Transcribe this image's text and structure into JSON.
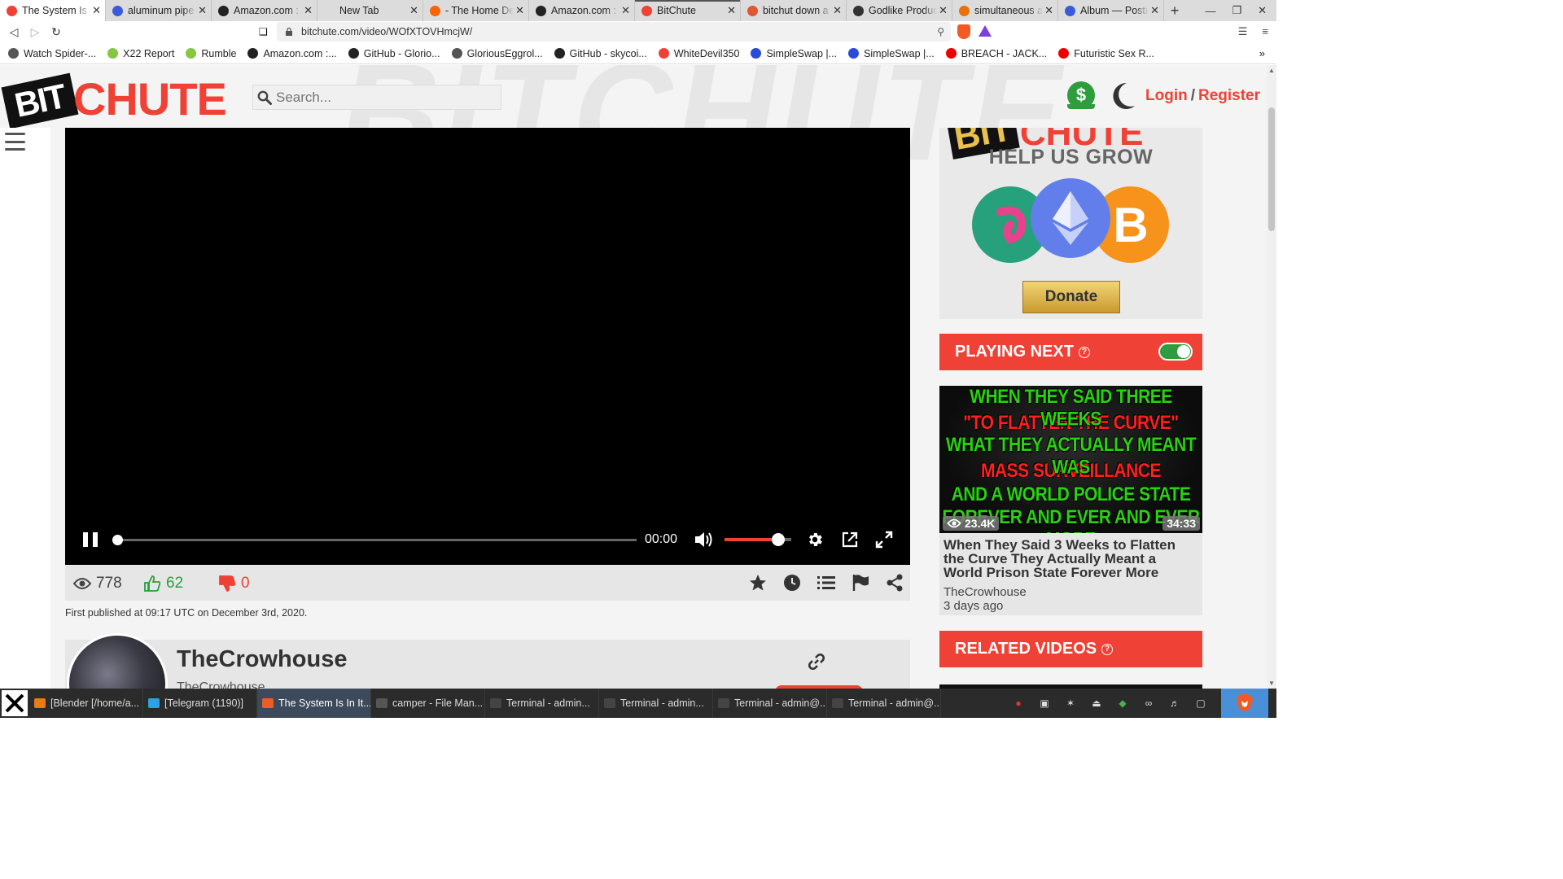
{
  "browser": {
    "tabs": [
      {
        "label": "The System Is In It",
        "fav_color": "#ef4136",
        "active": true
      },
      {
        "label": "aluminum pipe",
        "fav_color": "#3b5bdb"
      },
      {
        "label": "Amazon.com : \\",
        "fav_color": "#222"
      },
      {
        "label": "New Tab",
        "fav_color": ""
      },
      {
        "label": "- The Home Depot",
        "fav_color": "#f96302"
      },
      {
        "label": "Amazon.com : A",
        "fav_color": "#222"
      },
      {
        "label": "BitChute",
        "fav_color": "#ef4136",
        "loading": true
      },
      {
        "label": "bitchut down a",
        "fav_color": "#de5833"
      },
      {
        "label": "Godlike Produc",
        "fav_color": "#333"
      },
      {
        "label": "simultaneous a",
        "fav_color": "#e8710a"
      },
      {
        "label": "Album — Posti",
        "fav_color": "#3b5bdb"
      }
    ],
    "url": "bitchute.com/video/WOfXTOVHmcjW/",
    "bookmarks": [
      {
        "label": "Watch Spider-...",
        "color": "#555"
      },
      {
        "label": "X22 Report",
        "color": "#85c742"
      },
      {
        "label": "Rumble",
        "color": "#85c742"
      },
      {
        "label": "Amazon.com :...",
        "color": "#222"
      },
      {
        "label": "GitHub - Glorio...",
        "color": "#222"
      },
      {
        "label": "GloriousEggrol...",
        "color": "#555"
      },
      {
        "label": "GitHub - skycoi...",
        "color": "#222"
      },
      {
        "label": "WhiteDevil350",
        "color": "#ef4136"
      },
      {
        "label": "SimpleSwap |...",
        "color": "#2a4bd7"
      },
      {
        "label": "SimpleSwap |...",
        "color": "#2a4bd7"
      },
      {
        "label": "BREACH - JACK...",
        "color": "#e00"
      },
      {
        "label": "Futuristic Sex R...",
        "color": "#e00"
      }
    ]
  },
  "site": {
    "logo_bit": "BIT",
    "logo_chute": "CHUTE",
    "watermark": "BITCHUTE",
    "search_placeholder": "Search...",
    "login": "Login",
    "separator": "/",
    "register": "Register",
    "accent": "#ef4136"
  },
  "player": {
    "time": "00:00",
    "progress": 0,
    "volume": 0.8
  },
  "video": {
    "views": "778",
    "likes": "62",
    "dislikes": "0",
    "published": "First published at 09:17 UTC on December 3rd, 2020.",
    "channel_name": "TheCrowhouse",
    "channel_sub": "TheCrowhouse"
  },
  "sidebar": {
    "donate_heading": "HELP US GROW",
    "donate_brand": "CHUTE",
    "donate_btn": "Donate",
    "playing_next": "PLAYING NEXT",
    "playing_next_enabled": true,
    "next": {
      "thumb_lines": [
        {
          "text": "WHEN THEY SAID THREE WEEKS",
          "c": "g"
        },
        {
          "text": "\"TO FLATTEN THE CURVE\"",
          "c": "r"
        },
        {
          "text": "WHAT THEY ACTUALLY MEANT WAS",
          "c": "g"
        },
        {
          "text": "MASS SURVEILLANCE",
          "c": "r"
        },
        {
          "text": "AND A WORLD POLICE STATE",
          "c": "g"
        },
        {
          "text": "FOREVER AND EVER AND EVER MORE",
          "c": "g"
        }
      ],
      "views": "23.4K",
      "duration": "34:33",
      "title": "When They Said 3 Weeks to Flatten the Curve They Actually Meant a World Prison State Forever More",
      "channel": "TheCrowhouse",
      "age": "3 days ago"
    },
    "related": "RELATED VIDEOS"
  },
  "taskbar": {
    "tasks": [
      {
        "label": "[Blender [/home/a...",
        "icon": "#e87d0d"
      },
      {
        "label": "[Telegram (1190)]",
        "icon": "#2aa3df"
      },
      {
        "label": "The System Is In It...",
        "icon": "#f15a24",
        "active": true
      },
      {
        "label": "camper - File Man...",
        "icon": "#555"
      },
      {
        "label": "Terminal - admin...",
        "icon": "#444"
      },
      {
        "label": "Terminal - admin...",
        "icon": "#444"
      },
      {
        "label": "Terminal - admin@...",
        "icon": "#444"
      },
      {
        "label": "Terminal - admin@...",
        "icon": "#444"
      }
    ]
  }
}
